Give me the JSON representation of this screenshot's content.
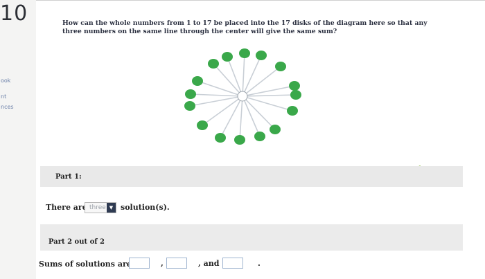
{
  "question_number": "10",
  "sidebar": {
    "items": [
      "ook",
      "nt",
      "nces"
    ]
  },
  "question_text": "How can the whole numbers from 1 to 17 be placed into the 17 disks of the diagram here so that any three numbers on the same line through the center will give the same sum?",
  "diagram": {
    "disk_count": 17,
    "disk_color": "#3aa84a",
    "center_color": "#ffffff"
  },
  "part1": {
    "label": "Part 1:",
    "prefix": "There are",
    "select_value": "three",
    "suffix": "solution(s)."
  },
  "part2": {
    "label": "Part 2 out of 2",
    "prefix": "Sums of solutions are",
    "sep1": ",",
    "sep2": ", and",
    "end": "."
  },
  "colors": {
    "accent_check": "#7fb52b",
    "dropdown_arrow_bg": "#2f3b52"
  }
}
